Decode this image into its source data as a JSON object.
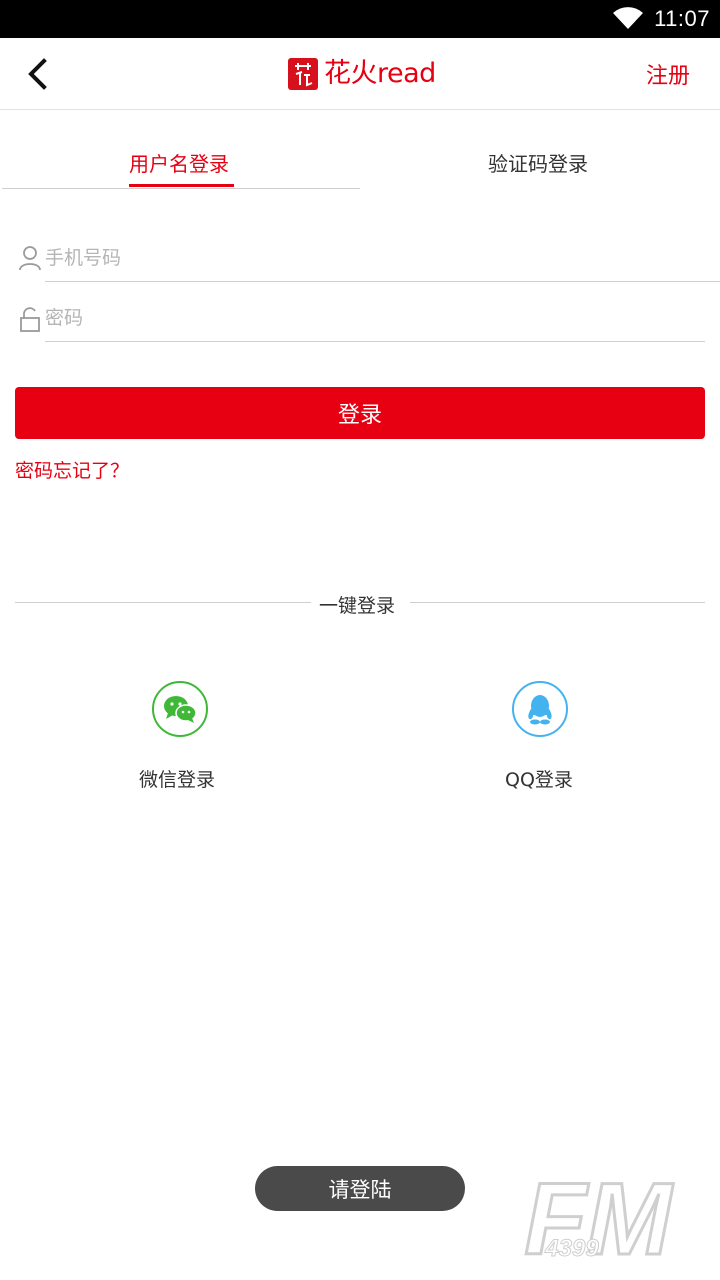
{
  "status_bar": {
    "time": "11:07"
  },
  "header": {
    "logo_text": "花火read",
    "register_label": "注册"
  },
  "tabs": [
    {
      "label": "用户名登录",
      "active": true
    },
    {
      "label": "验证码登录",
      "active": false
    }
  ],
  "form": {
    "phone_placeholder": "手机号码",
    "phone_value": "",
    "password_placeholder": "密码",
    "password_value": "",
    "login_label": "登录",
    "forgot_label": "密码忘记了？"
  },
  "quick_login": {
    "title": "一键登录",
    "options": [
      {
        "label": "微信登录",
        "icon": "wechat-icon",
        "color": "#3fb838"
      },
      {
        "label": "QQ登录",
        "icon": "qq-icon",
        "color": "#45b2f0"
      }
    ]
  },
  "toast": {
    "text": "请登陆"
  },
  "watermark": {
    "text": "FM",
    "sub": "4399"
  },
  "colors": {
    "accent": "#e60012",
    "toast_bg": "#4a4a4a"
  }
}
